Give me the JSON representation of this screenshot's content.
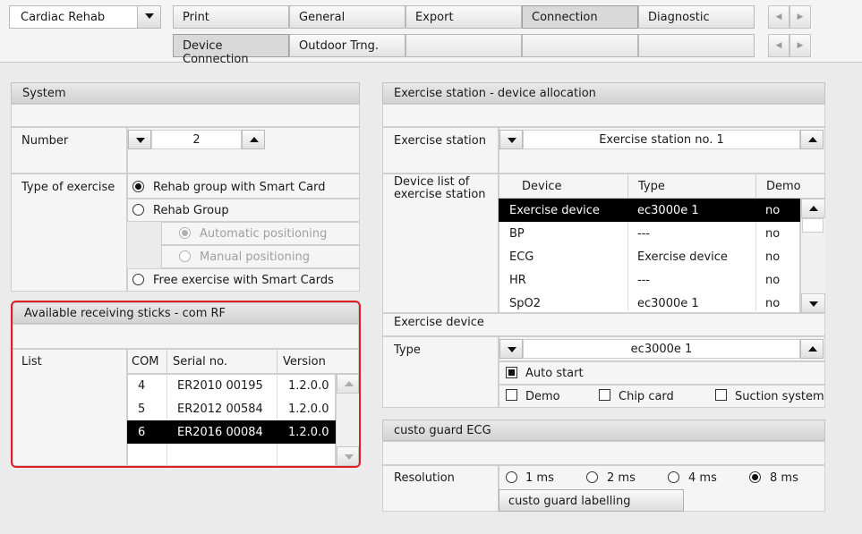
{
  "toolbar": {
    "app_selector": "Cardiac Rehab",
    "tabs_row1": [
      "Print",
      "General",
      "Export",
      "Connection",
      "Diagnostic"
    ],
    "tabs_row2": [
      "Device Connection",
      "Outdoor Trng."
    ],
    "active_tab_row1": "Connection",
    "active_tab_row2": "Device Connection"
  },
  "system": {
    "title": "System",
    "number_label": "Number",
    "number_value": "2",
    "type_label": "Type of exercise",
    "options": {
      "rehab_smart": "Rehab group with Smart Card",
      "rehab_group": "Rehab Group",
      "auto_pos": "Automatic positioning",
      "manual_pos": "Manual positioning",
      "free_smart": "Free exercise with Smart Cards"
    }
  },
  "sticks": {
    "title": "Available receiving sticks - com RF",
    "list_label": "List",
    "columns": [
      "COM",
      "Serial no.",
      "Version"
    ],
    "rows": [
      {
        "com": "4",
        "serial": "ER2010 00195",
        "version": "1.2.0.0"
      },
      {
        "com": "5",
        "serial": "ER2012 00584",
        "version": "1.2.0.0"
      },
      {
        "com": "6",
        "serial": "ER2016 00084",
        "version": "1.2.0.0"
      }
    ]
  },
  "station": {
    "title": "Exercise station - device allocation",
    "station_label": "Exercise station",
    "station_value": "Exercise station no. 1",
    "device_list_label": "Device list of exercise station",
    "columns": [
      "Device",
      "Type",
      "Demo"
    ],
    "rows": [
      {
        "device": "Exercise device",
        "type": "ec3000e 1",
        "demo": "no"
      },
      {
        "device": "BP",
        "type": "---",
        "demo": "no"
      },
      {
        "device": "ECG",
        "type": "Exercise device",
        "demo": "no"
      },
      {
        "device": "HR",
        "type": "---",
        "demo": "no"
      },
      {
        "device": "SpO2",
        "type": "ec3000e 1",
        "demo": "no"
      }
    ],
    "exercise_device_label": "Exercise device",
    "type_label": "Type",
    "type_value": "ec3000e 1",
    "auto_start": "Auto start",
    "demo": "Demo",
    "chip_card": "Chip card",
    "suction": "Suction system"
  },
  "guard": {
    "title": "custo guard ECG",
    "resolution_label": "Resolution",
    "options": [
      "1 ms",
      "2 ms",
      "4 ms",
      "8 ms"
    ],
    "selected": "8 ms",
    "labelling_button": "custo guard labelling"
  }
}
